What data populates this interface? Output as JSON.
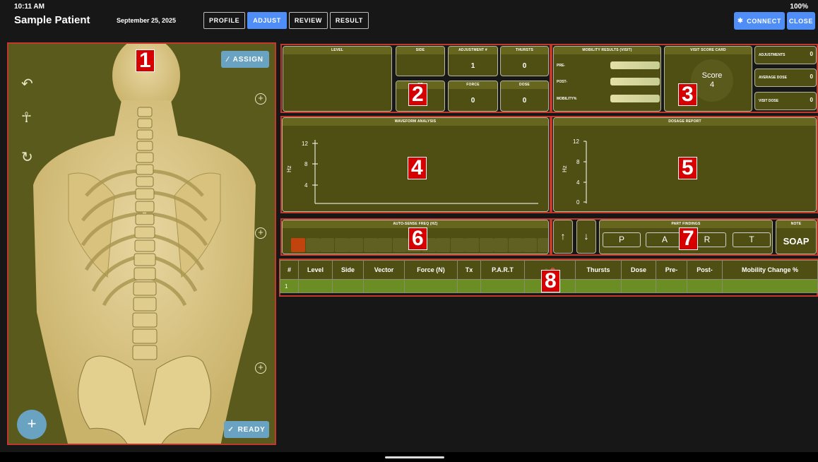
{
  "status": {
    "time": "10:11 AM",
    "battery": "100%"
  },
  "header": {
    "patient_name": "Sample Patient",
    "date": "September 25, 2025",
    "tabs": [
      {
        "label": "PROFILE",
        "active": false
      },
      {
        "label": "ADJUST",
        "active": true
      },
      {
        "label": "REVIEW",
        "active": false
      },
      {
        "label": "RESULT",
        "active": false
      }
    ],
    "connect_label": "CONNECT",
    "close_label": "CLOSE"
  },
  "regions": [
    "1",
    "2",
    "3",
    "4",
    "5",
    "6",
    "7",
    "8"
  ],
  "body_panel": {
    "assign_label": "ASSIGN",
    "ready_label": "READY",
    "fab_symbol": "+",
    "icons": [
      "undo-icon",
      "body-posture-icon",
      "refresh-icon",
      "add-circle-icon"
    ]
  },
  "adjust": {
    "level_title": "LEVEL",
    "side_title": "SIDE",
    "adjustment_title": "ADJUSTMENT #",
    "adjustment_value": "1",
    "thrusts_title": "THURSTS",
    "thrusts_value": "0",
    "vector_title": "OR",
    "force_title": "FORCE",
    "force_value": "0",
    "dose_title": "DOSE",
    "dose_value": "0"
  },
  "mobility": {
    "title": "MOBILITY RESULTS (VISIT)",
    "rows": [
      "PRE-",
      "POST-",
      "MOBILITY%"
    ]
  },
  "score_card": {
    "title": "VISIT SCORE CARD",
    "label": "Score",
    "value": "4"
  },
  "stats": [
    {
      "label": "ADJUSTMENTS",
      "value": "0"
    },
    {
      "label": "AVERAGE DOSE",
      "value": "0"
    },
    {
      "label": "VISIT DOSE",
      "value": "0"
    }
  ],
  "waveform": {
    "title": "WAVEFORM ANALYSIS",
    "ylabel": "Hz",
    "ticks": [
      "12",
      "8",
      "4"
    ]
  },
  "dosage": {
    "title": "DOSAGE REPORT",
    "ylabel": "Hz",
    "ticks": [
      "12",
      "8",
      "4",
      "0"
    ]
  },
  "autosense": {
    "title": "AUTO-SENSE FREQ (HZ)",
    "segment_count": 18,
    "active_segments": 1,
    "active_color": "#c1440e"
  },
  "part": {
    "title": "PART FINDINGS",
    "letters": [
      "P",
      "A",
      "R",
      "T"
    ],
    "note_title": "NOTE",
    "note_label": "SOAP"
  },
  "table": {
    "headers": [
      "#",
      "Level",
      "Side",
      "Vector",
      "Force (N)",
      "Tx",
      "P.A.R.T",
      "",
      "Thursts",
      "Dose",
      "Pre-",
      "Post-",
      "Mobility Change %"
    ],
    "rows": [
      [
        "1",
        "",
        "",
        "",
        "",
        "",
        "",
        "",
        "",
        "",
        "",
        "",
        ""
      ]
    ]
  },
  "colors": {
    "accent": "#4f8ef7",
    "panel": "#4f4f14",
    "highlight": "#c0392b"
  }
}
